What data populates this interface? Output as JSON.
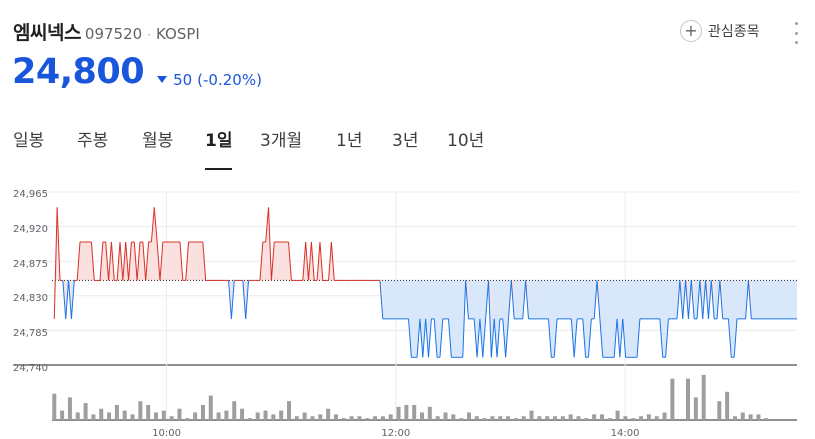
{
  "stock": {
    "name": "엠씨넥스",
    "code": "097520",
    "separator": "·",
    "market": "KOSPI",
    "watch_label": "관심종목",
    "price": "24,800",
    "change": "50",
    "change_pct": "(-0.20%)",
    "direction": "down"
  },
  "tabs": [
    {
      "label": "일봉",
      "active": false
    },
    {
      "label": "주봉",
      "active": false
    },
    {
      "label": "월봉",
      "active": false
    },
    {
      "label": "1일",
      "active": true
    },
    {
      "label": "3개월",
      "active": false
    },
    {
      "label": "1년",
      "active": false
    },
    {
      "label": "3년",
      "active": false
    },
    {
      "label": "10년",
      "active": false
    }
  ],
  "icons": {
    "watch": "plus-circle-icon",
    "more": "more-vertical-icon",
    "change": "down-triangle-icon"
  },
  "colors": {
    "up": "#d93025",
    "down": "#1a73e8",
    "price": "#1a56db",
    "volume": "#9e9e9e",
    "up_fill": "#fbe0e0",
    "down_fill": "#d8e8fa"
  },
  "chart_data": {
    "type": "line",
    "baseline": 24850,
    "y_ticks": [
      "24,965",
      "24,920",
      "24,875",
      "24,830",
      "24,785",
      "24,740"
    ],
    "ylim": [
      24740,
      24965
    ],
    "x_ticks": [
      "10:00",
      "12:00",
      "14:00"
    ],
    "x_tick_hours": [
      10,
      12,
      14
    ],
    "xlim": [
      9,
      15.5
    ],
    "grid": true,
    "baseline_style": "dotted",
    "series": [
      {
        "values": [
          24800,
          24945,
          24850,
          24850,
          24800,
          24850,
          24800,
          24850,
          24850,
          24900,
          24900,
          24900,
          24900,
          24900,
          24850,
          24850,
          24850,
          24900,
          24900,
          24850,
          24900,
          24850,
          24850,
          24900,
          24850,
          24900,
          24850,
          24900,
          24900,
          24850,
          24900,
          24900,
          24850,
          24900,
          24900,
          24945,
          24900,
          24850,
          24900,
          24900,
          24900,
          24900,
          24900,
          24900,
          24900,
          24850,
          24850,
          24900,
          24900,
          24900,
          24900,
          24900,
          24900,
          24850,
          24850,
          24850,
          24850,
          24850,
          24850,
          24850,
          24850,
          24850,
          24800,
          24850,
          24850,
          24850,
          24850,
          24800,
          24850,
          24850,
          24850,
          24850,
          24850,
          24900,
          24900,
          24945,
          24850,
          24900,
          24900,
          24900,
          24900,
          24900,
          24900,
          24850,
          24850,
          24850,
          24850,
          24850,
          24900,
          24850,
          24900,
          24850,
          24850,
          24900,
          24850,
          24850,
          24850,
          24900,
          24850,
          24850,
          24850,
          24850,
          24850,
          24850,
          24850,
          24850,
          24850,
          24850,
          24850,
          24850,
          24850,
          24850,
          24850,
          24850,
          24850,
          24800,
          24800,
          24800,
          24800,
          24800,
          24800,
          24800,
          24800,
          24800,
          24800,
          24750,
          24750,
          24750,
          24800,
          24750,
          24800,
          24750,
          24800,
          24800,
          24750,
          24750,
          24800,
          24800,
          24800,
          24750,
          24750,
          24750,
          24750,
          24750,
          24850,
          24800,
          24800,
          24800,
          24750,
          24800,
          24750,
          24800,
          24850,
          24750,
          24800,
          24750,
          24800,
          24800,
          24750,
          24800,
          24850,
          24800,
          24800,
          24800,
          24800,
          24850,
          24800,
          24800,
          24800,
          24800,
          24800,
          24800,
          24800,
          24800,
          24750,
          24750,
          24800,
          24800,
          24800,
          24800,
          24800,
          24800,
          24750,
          24800,
          24800,
          24800,
          24750,
          24750,
          24800,
          24800,
          24850,
          24800,
          24750,
          24750,
          24750,
          24750,
          24750,
          24800,
          24750,
          24800,
          24750,
          24750,
          24750,
          24750,
          24750,
          24800,
          24800,
          24800,
          24800,
          24800,
          24800,
          24800,
          24800,
          24750,
          24750,
          24800,
          24800,
          24800,
          24800,
          24850,
          24800,
          24850,
          24800,
          24850,
          24800,
          24800,
          24850,
          24800,
          24850,
          24800,
          24850,
          24800,
          24800,
          24850,
          24800,
          24800,
          24800,
          24750,
          24750,
          24800,
          24800,
          24800,
          24800,
          24850,
          24800,
          24800,
          24800,
          24800,
          24800,
          24800,
          24800,
          24800,
          24800,
          24800,
          24800,
          24800,
          24800,
          24800,
          24800,
          24800,
          24800
        ]
      }
    ],
    "volume": {
      "values": [
        14,
        5,
        12,
        4,
        9,
        3,
        6,
        4,
        8,
        5,
        3,
        10,
        8,
        4,
        5,
        2,
        6,
        1,
        4,
        8,
        13,
        4,
        5,
        10,
        6,
        1,
        4,
        5,
        3,
        5,
        10,
        2,
        4,
        2,
        3,
        6,
        3,
        1,
        2,
        2,
        1,
        2,
        2,
        3,
        7,
        8,
        8,
        4,
        7,
        2,
        4,
        3,
        1,
        4,
        2,
        1,
        2,
        2,
        2,
        1,
        2,
        5,
        2,
        2,
        2,
        2,
        3,
        2,
        1,
        3,
        3,
        1,
        5,
        2,
        1,
        2,
        3,
        2,
        4,
        22,
        0,
        22,
        12,
        24,
        0,
        10,
        15,
        2,
        4,
        3,
        3,
        1,
        0
      ],
      "ylim": [
        0,
        25
      ]
    }
  }
}
